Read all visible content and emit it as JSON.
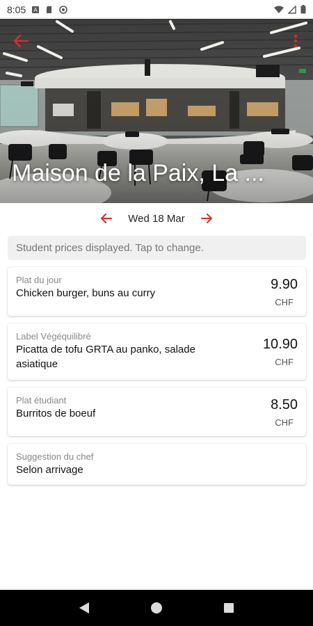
{
  "status_bar": {
    "time": "8:05"
  },
  "header": {
    "title": "Maison de la Paix, La ..."
  },
  "date_nav": {
    "date": "Wed 18 Mar"
  },
  "notice": "Student prices displayed. Tap to change.",
  "menu": [
    {
      "category": "Plat du jour",
      "name": "Chicken burger, buns au curry",
      "price": "9.90",
      "currency": "CHF"
    },
    {
      "category": "Label Végéquilibré",
      "name": "Picatta de tofu GRTA au panko, salade asiatique",
      "price": "10.90",
      "currency": "CHF"
    },
    {
      "category": "Plat étudiant",
      "name": "Burritos de boeuf",
      "price": "8.50",
      "currency": "CHF"
    },
    {
      "category": "Suggestion du chef",
      "name": "Selon arrivage",
      "price": "",
      "currency": ""
    }
  ],
  "colors": {
    "accent": "#d32f2f"
  },
  "icons": [
    "back-arrow-icon",
    "more-vert-icon",
    "chevron-left-icon",
    "chevron-right-icon",
    "wifi-icon",
    "signal-icon",
    "battery-icon",
    "back-triangle-icon",
    "home-circle-icon",
    "recents-square-icon"
  ]
}
